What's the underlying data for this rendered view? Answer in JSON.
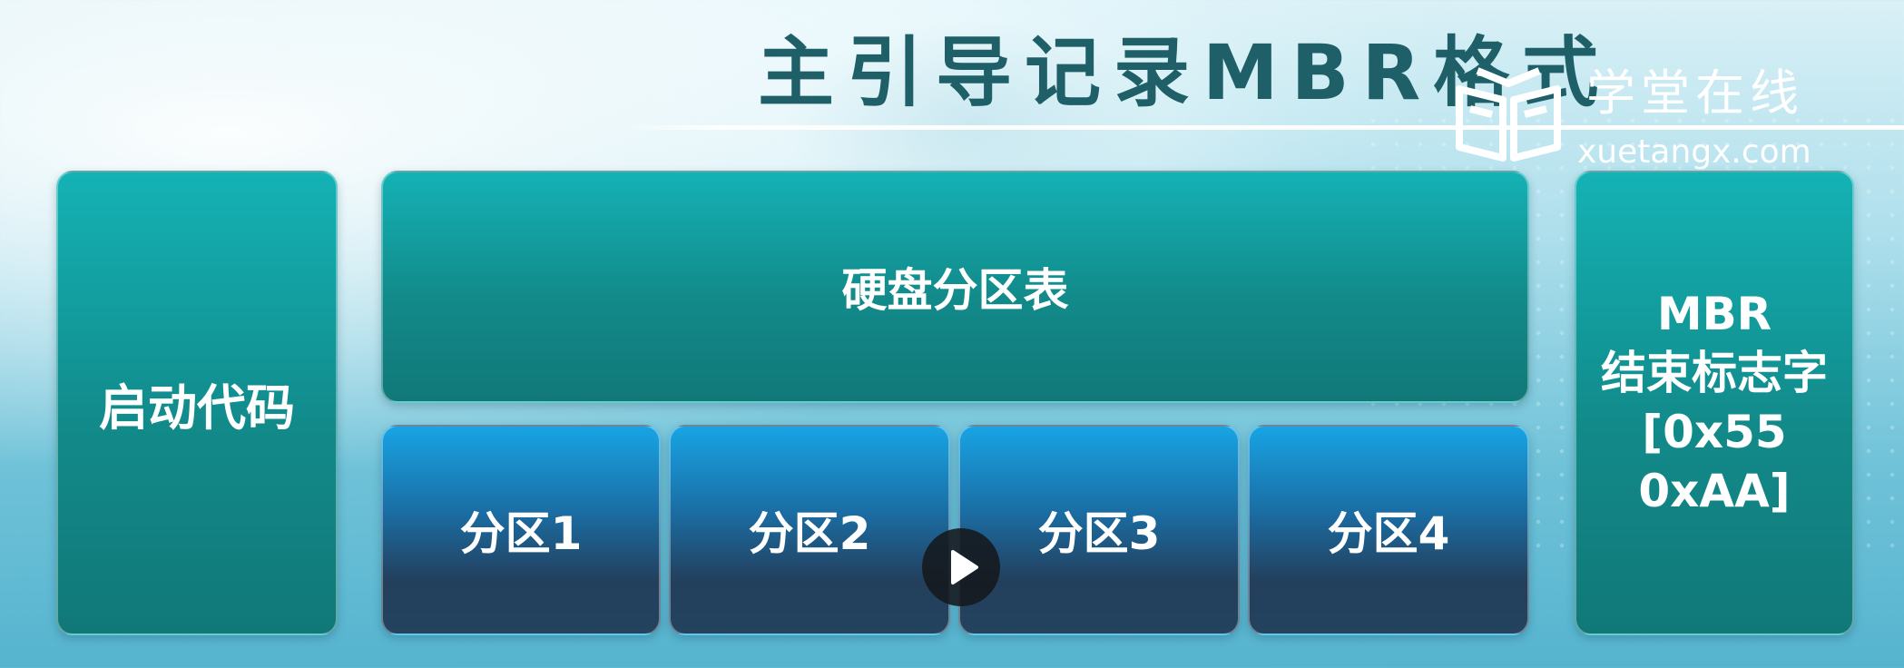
{
  "title": "主引导记录MBR格式",
  "logo": {
    "name_cn": "学堂在线",
    "domain": "xuetangx.com",
    "icon": "book-logo-icon"
  },
  "diagram": {
    "boot_code": "启动代码",
    "partition_table": "硬盘分区表",
    "partitions": [
      "分区1",
      "分区2",
      "分区3",
      "分区4"
    ],
    "end_signature": {
      "line1": "MBR",
      "line2": "结束标志字",
      "line3": "[0x55",
      "line4": "0xAA]"
    }
  },
  "player": {
    "play_icon": "play-icon"
  },
  "colors": {
    "teal_box": "#128a8a",
    "partition_top": "#18a4e4",
    "partition_bottom": "#23435f",
    "title_text": "#1f5f68"
  }
}
